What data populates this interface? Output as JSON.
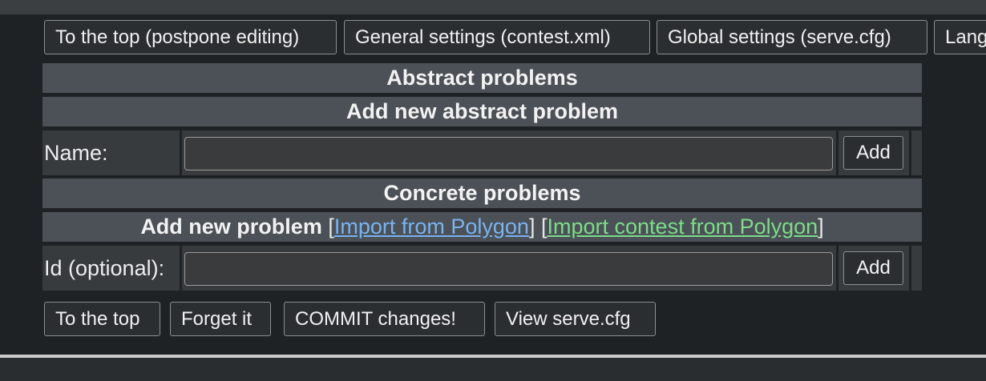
{
  "top_nav": {
    "to_top_postpone": "To the top (postpone editing)",
    "general_settings": "General settings (contest.xml)",
    "global_settings": "Global settings (serve.cfg)",
    "language": "Lang"
  },
  "abstract_section": {
    "title": "Abstract problems",
    "add_title": "Add new abstract problem",
    "name_label": "Name:",
    "name_value": "",
    "add_button": "Add"
  },
  "concrete_section": {
    "title": "Concrete problems",
    "add_title": "Add new problem",
    "bracket_open_1": "[",
    "import_polygon": "Import from Polygon",
    "bracket_close_1": "]",
    "bracket_open_2": "[",
    "import_contest_polygon": "Import contest from Polygon",
    "bracket_close_2": "]",
    "id_label": "Id (optional):",
    "id_value": "",
    "add_button": "Add"
  },
  "bottom_nav": {
    "to_top": "To the top",
    "forget_it": "Forget it",
    "commit": "COMMIT changes!",
    "view_serve": "View serve.cfg"
  },
  "colors": {
    "page_bg": "#1f2224",
    "header_bg": "#4b5156",
    "cell_bg": "#373b3e",
    "link_blue": "#79b3f2",
    "link_green": "#7ddc8a"
  }
}
